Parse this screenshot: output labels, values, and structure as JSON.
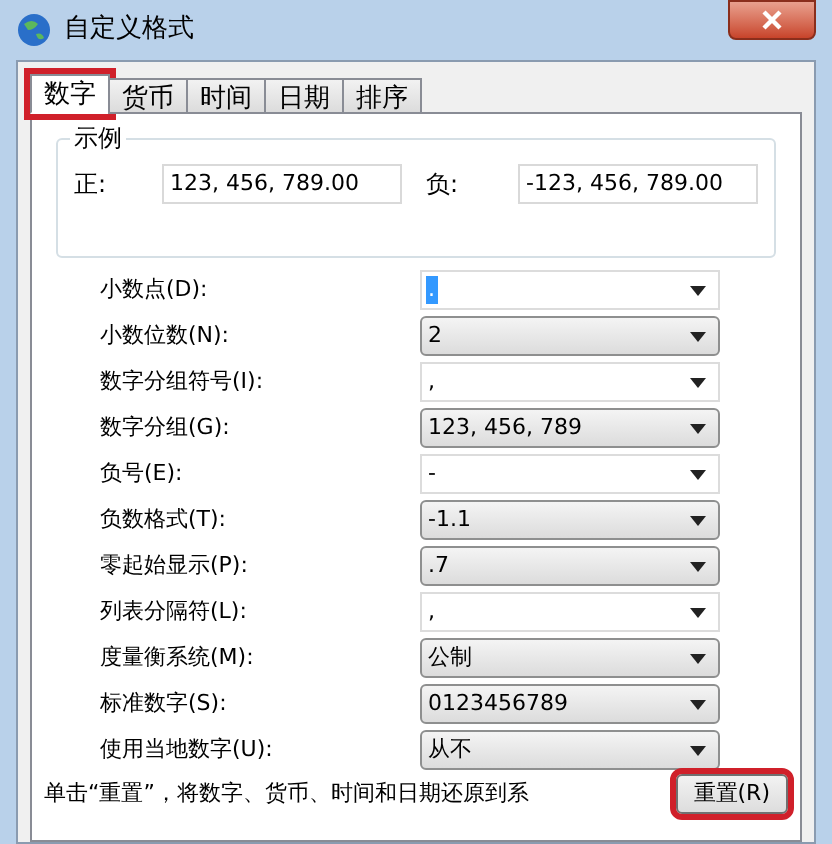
{
  "window": {
    "title": "自定义格式"
  },
  "tabs": [
    {
      "label": "数字",
      "selected": true,
      "highlighted": true
    },
    {
      "label": "货币",
      "selected": false,
      "highlighted": false
    },
    {
      "label": "时间",
      "selected": false,
      "highlighted": false
    },
    {
      "label": "日期",
      "selected": false,
      "highlighted": false
    },
    {
      "label": "排序",
      "selected": false,
      "highlighted": false
    }
  ],
  "sample": {
    "title": "示例",
    "positive_label": "正:",
    "positive_value": "123, 456, 789.00",
    "negative_label": "负:",
    "negative_value": "-123, 456, 789.00"
  },
  "settings": [
    {
      "label": "小数点(D):",
      "value": ".",
      "kind": "editable",
      "focused": true
    },
    {
      "label": "小数位数(N):",
      "value": "2",
      "kind": "list",
      "focused": false
    },
    {
      "label": "数字分组符号(I):",
      "value": ",",
      "kind": "editable",
      "focused": false
    },
    {
      "label": "数字分组(G):",
      "value": "123, 456, 789",
      "kind": "list",
      "focused": false
    },
    {
      "label": "负号(E):",
      "value": "-",
      "kind": "editable",
      "focused": false
    },
    {
      "label": "负数格式(T):",
      "value": "-1.1",
      "kind": "list",
      "focused": false
    },
    {
      "label": "零起始显示(P):",
      "value": ".7",
      "kind": "list",
      "focused": false
    },
    {
      "label": "列表分隔符(L):",
      "value": ",",
      "kind": "editable",
      "focused": false
    },
    {
      "label": "度量衡系统(M):",
      "value": "公制",
      "kind": "list",
      "focused": false
    },
    {
      "label": "标准数字(S):",
      "value": "0123456789",
      "kind": "list",
      "focused": false
    },
    {
      "label": "使用当地数字(U):",
      "value": "从不",
      "kind": "list",
      "focused": false
    }
  ],
  "footer": {
    "text": "单击“重置”，将数字、货币、时间和日期还原到系",
    "reset_button": {
      "label": "重置(R)",
      "highlighted": true
    }
  }
}
